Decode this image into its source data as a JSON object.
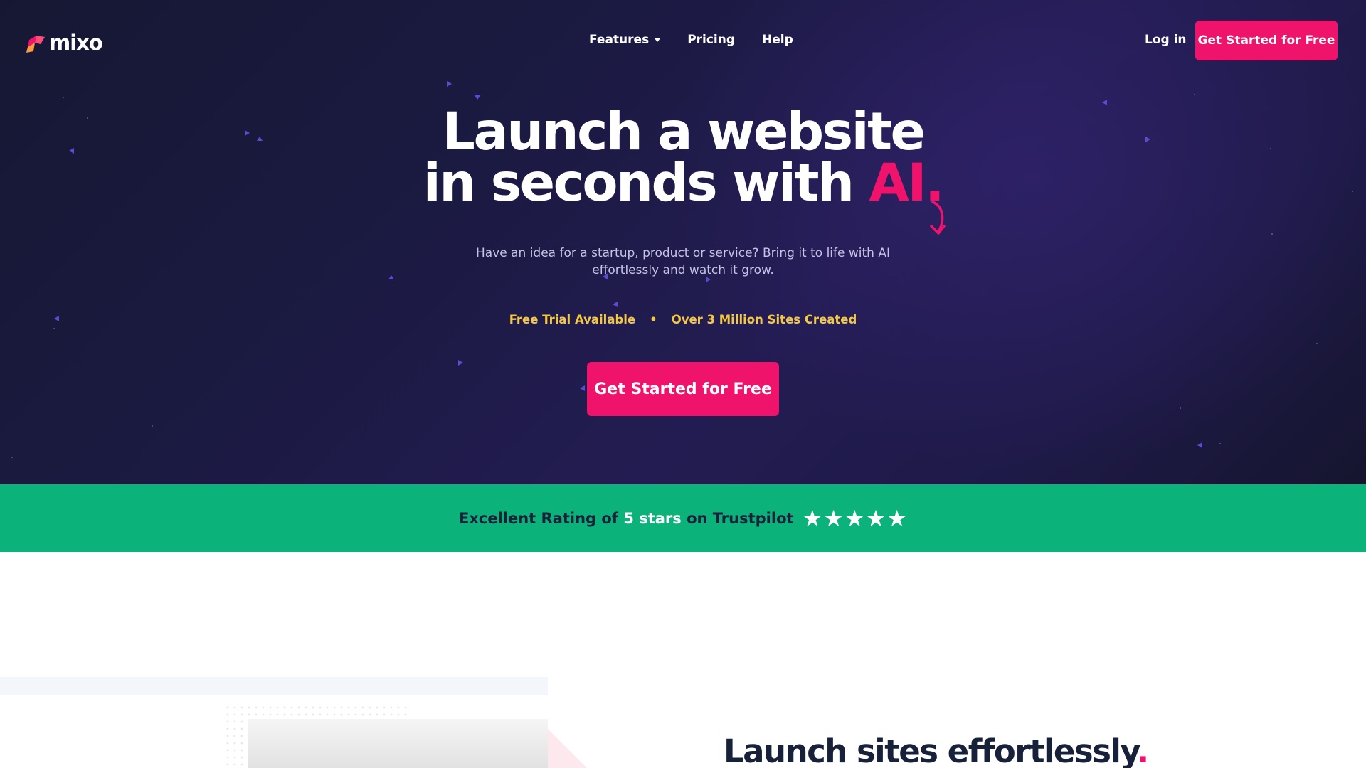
{
  "nav": {
    "logo_text": "mixo",
    "links": [
      {
        "label": "Features"
      },
      {
        "label": "Pricing"
      },
      {
        "label": "Help"
      }
    ],
    "login_label": "Log in",
    "cta_label": "Get Started for Free"
  },
  "hero": {
    "headline_line1": "Launch a website",
    "headline_line2_prefix": "in seconds with ",
    "headline_accent": "AI.",
    "subtitle": "Have an idea for a startup, product or service? Bring it to life with AI effortlessly and watch it grow.",
    "feature_1": "Free Trial Available",
    "separator": "•",
    "feature_2": "Over 3 Million Sites Created",
    "cta_label": "Get Started for Free"
  },
  "trust": {
    "prefix": "Excellent Rating of ",
    "highlight": "5 stars",
    "suffix": " on Trustpilot",
    "rating": 5
  },
  "section": {
    "title": "Launch sites effortlessly",
    "title_dot": "."
  },
  "colors": {
    "accent": "#f0136b",
    "hero_bg": "#1b1a42",
    "trust_green": "#0bb37a",
    "feature_yellow": "#f5c842"
  }
}
